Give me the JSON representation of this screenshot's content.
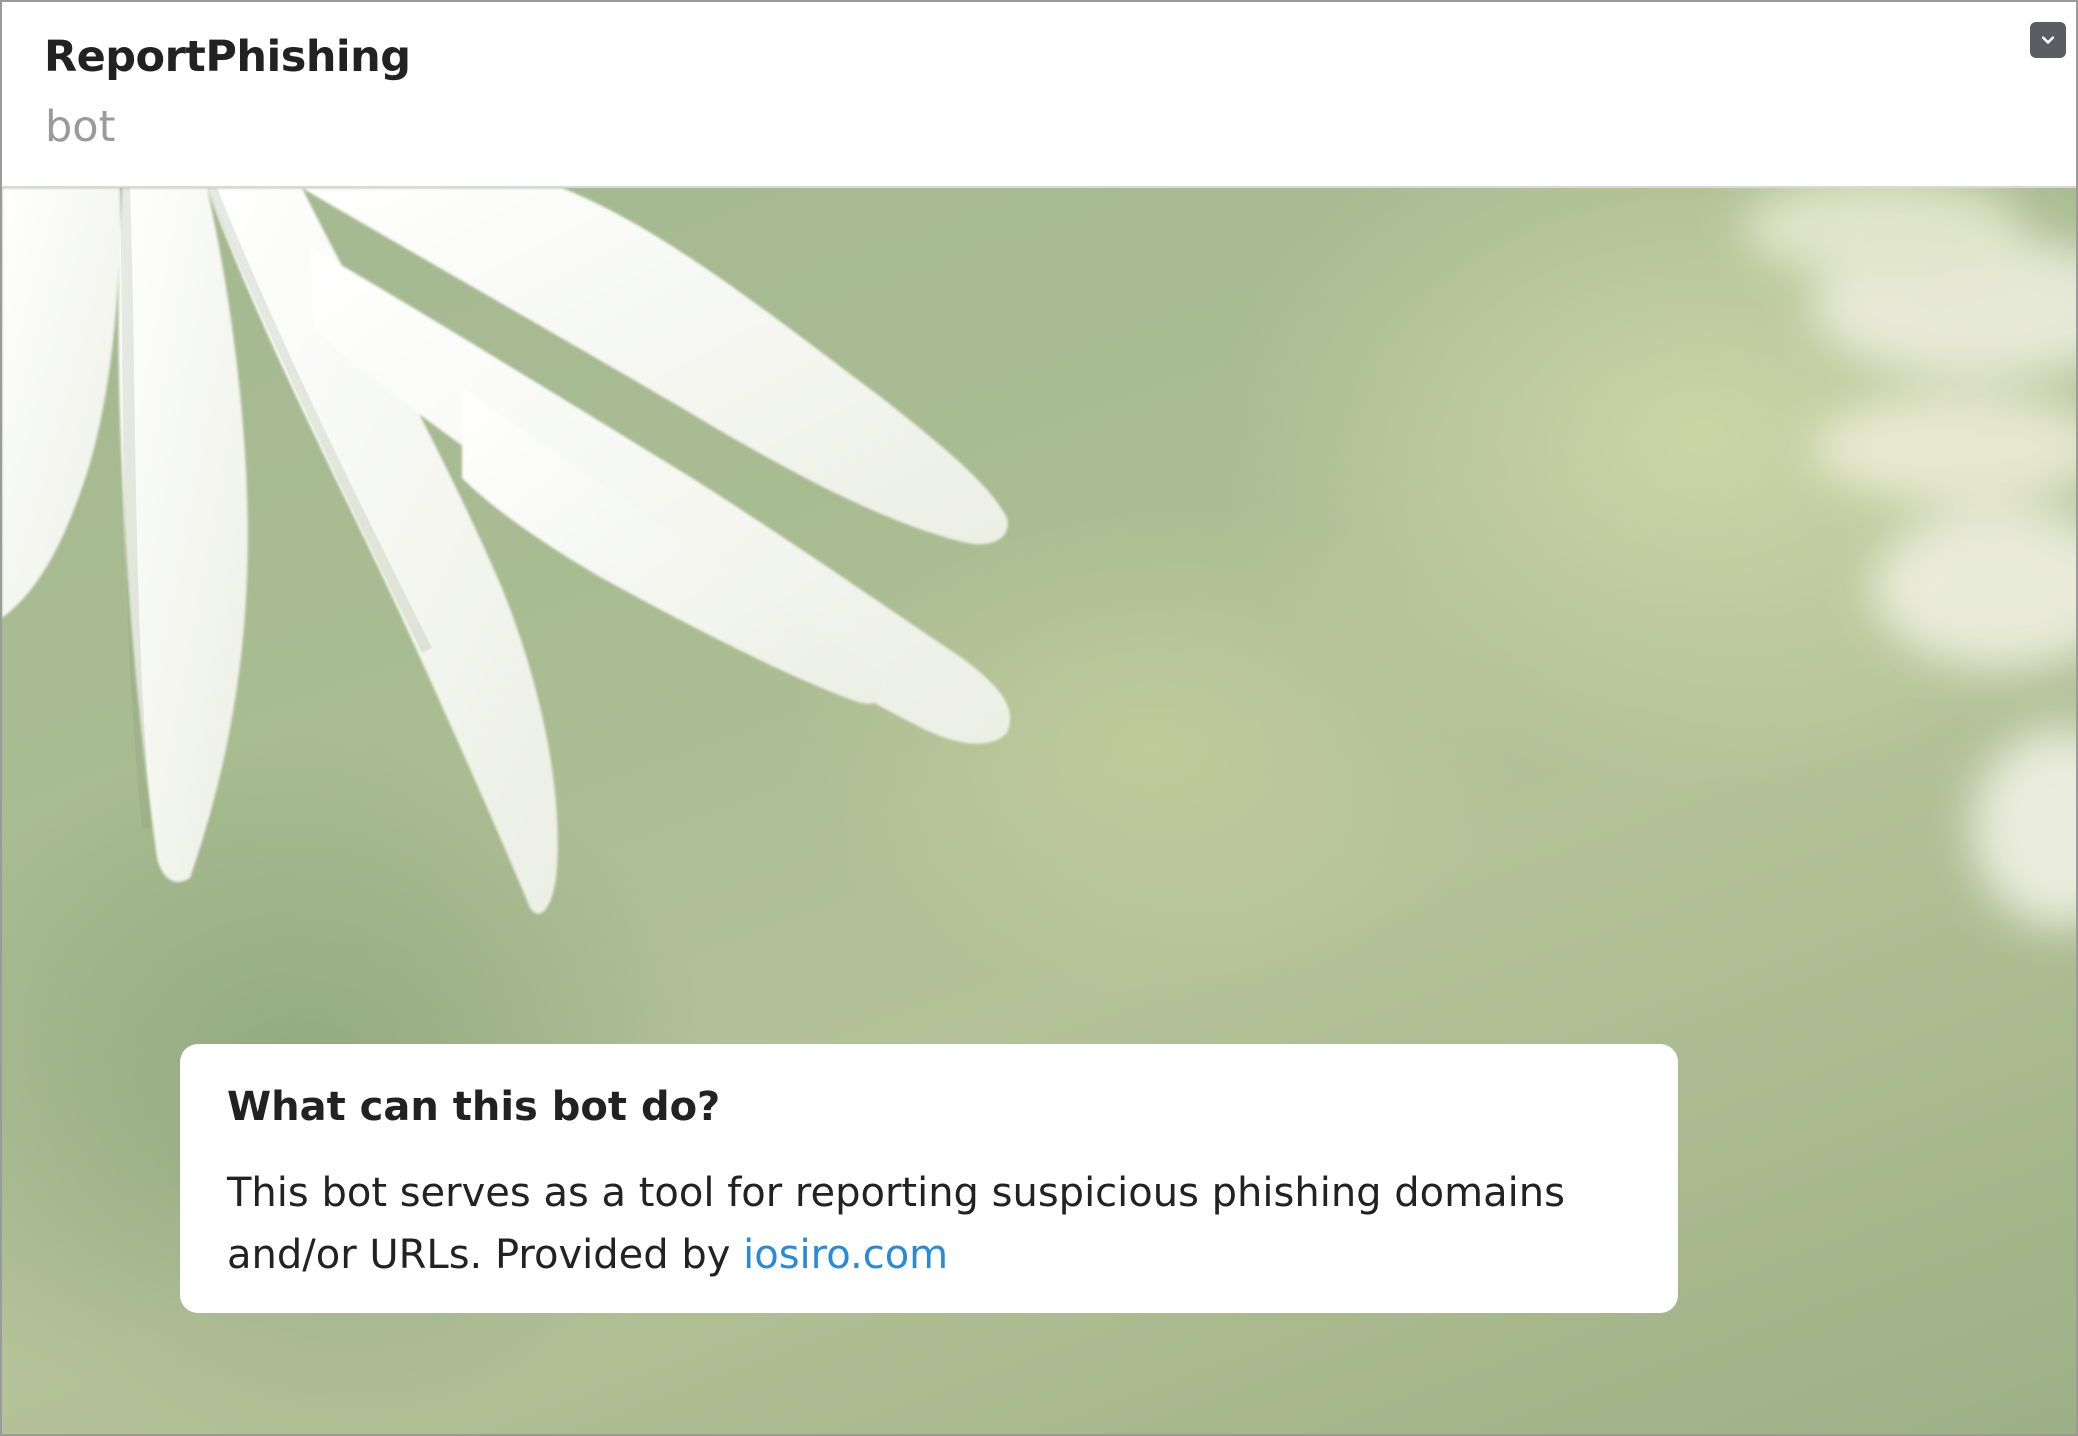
{
  "header": {
    "title": "ReportPhishing",
    "subtitle": "bot",
    "dropdown_icon": "chevron-down-icon"
  },
  "info_card": {
    "heading": "What can this bot do?",
    "description": "This bot serves as a tool for reporting suspicious phishing domains and/or URLs. Provided by ",
    "link_text": "iosiro.com"
  },
  "colors": {
    "link": "#2b8ad6",
    "dropdown_bg": "#5a5d62",
    "title": "#222222",
    "subtitle": "#9a9a9a"
  }
}
